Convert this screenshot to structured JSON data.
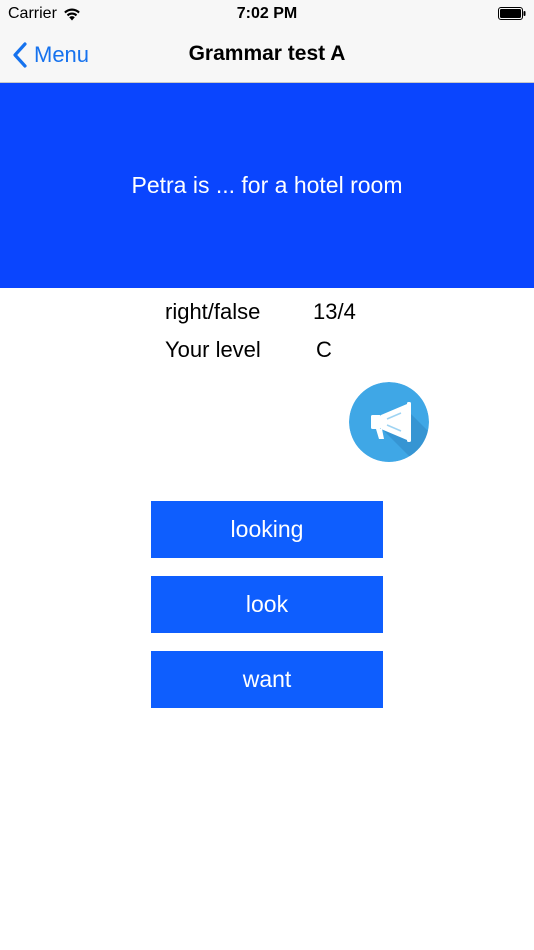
{
  "status_bar": {
    "carrier": "Carrier",
    "time": "7:02 PM"
  },
  "nav": {
    "back_label": "Menu",
    "title": "Grammar test A"
  },
  "question": {
    "text": "Petra is ... for a hotel room"
  },
  "stats": {
    "right_false_label": "right/false",
    "right_false_value": "13/4",
    "level_label": "Your level",
    "level_value": "C"
  },
  "answers": [
    {
      "label": "looking"
    },
    {
      "label": "look"
    },
    {
      "label": "want"
    }
  ],
  "colors": {
    "banner": "#0a45fe",
    "answer_button": "#0e5efe",
    "nav_tint": "#1672ee",
    "speaker_circle": "#3fa7e6"
  },
  "icons": {
    "speaker": "megaphone-icon",
    "back": "chevron-left-icon",
    "wifi": "wifi-icon",
    "battery": "battery-icon"
  }
}
